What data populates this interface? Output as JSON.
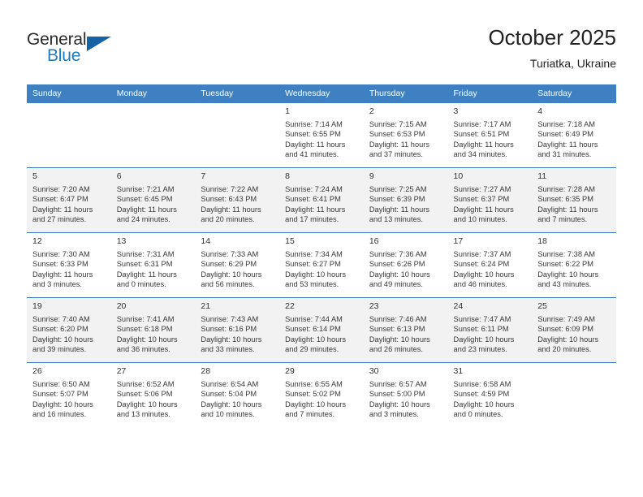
{
  "brand": {
    "name_top": "General",
    "name_bottom": "Blue",
    "accent_color": "#1f7ac4",
    "triangle_color": "#1464a5"
  },
  "header": {
    "title": "October 2025",
    "subtitle": "Turiatka, Ukraine"
  },
  "theme": {
    "header_row_bg": "#3f80c3",
    "header_row_text": "#ffffff",
    "alt_row_bg": "#f2f2f2",
    "row_divider": "#3f80c3"
  },
  "weekday_headers": [
    "Sunday",
    "Monday",
    "Tuesday",
    "Wednesday",
    "Thursday",
    "Friday",
    "Saturday"
  ],
  "weeks": [
    {
      "alt": false,
      "days": [
        {
          "empty": true
        },
        {
          "empty": true
        },
        {
          "empty": true
        },
        {
          "num": "1",
          "sunrise": "Sunrise: 7:14 AM",
          "sunset": "Sunset: 6:55 PM",
          "daylight1": "Daylight: 11 hours",
          "daylight2": "and 41 minutes."
        },
        {
          "num": "2",
          "sunrise": "Sunrise: 7:15 AM",
          "sunset": "Sunset: 6:53 PM",
          "daylight1": "Daylight: 11 hours",
          "daylight2": "and 37 minutes."
        },
        {
          "num": "3",
          "sunrise": "Sunrise: 7:17 AM",
          "sunset": "Sunset: 6:51 PM",
          "daylight1": "Daylight: 11 hours",
          "daylight2": "and 34 minutes."
        },
        {
          "num": "4",
          "sunrise": "Sunrise: 7:18 AM",
          "sunset": "Sunset: 6:49 PM",
          "daylight1": "Daylight: 11 hours",
          "daylight2": "and 31 minutes."
        }
      ]
    },
    {
      "alt": true,
      "days": [
        {
          "num": "5",
          "sunrise": "Sunrise: 7:20 AM",
          "sunset": "Sunset: 6:47 PM",
          "daylight1": "Daylight: 11 hours",
          "daylight2": "and 27 minutes."
        },
        {
          "num": "6",
          "sunrise": "Sunrise: 7:21 AM",
          "sunset": "Sunset: 6:45 PM",
          "daylight1": "Daylight: 11 hours",
          "daylight2": "and 24 minutes."
        },
        {
          "num": "7",
          "sunrise": "Sunrise: 7:22 AM",
          "sunset": "Sunset: 6:43 PM",
          "daylight1": "Daylight: 11 hours",
          "daylight2": "and 20 minutes."
        },
        {
          "num": "8",
          "sunrise": "Sunrise: 7:24 AM",
          "sunset": "Sunset: 6:41 PM",
          "daylight1": "Daylight: 11 hours",
          "daylight2": "and 17 minutes."
        },
        {
          "num": "9",
          "sunrise": "Sunrise: 7:25 AM",
          "sunset": "Sunset: 6:39 PM",
          "daylight1": "Daylight: 11 hours",
          "daylight2": "and 13 minutes."
        },
        {
          "num": "10",
          "sunrise": "Sunrise: 7:27 AM",
          "sunset": "Sunset: 6:37 PM",
          "daylight1": "Daylight: 11 hours",
          "daylight2": "and 10 minutes."
        },
        {
          "num": "11",
          "sunrise": "Sunrise: 7:28 AM",
          "sunset": "Sunset: 6:35 PM",
          "daylight1": "Daylight: 11 hours",
          "daylight2": "and 7 minutes."
        }
      ]
    },
    {
      "alt": false,
      "days": [
        {
          "num": "12",
          "sunrise": "Sunrise: 7:30 AM",
          "sunset": "Sunset: 6:33 PM",
          "daylight1": "Daylight: 11 hours",
          "daylight2": "and 3 minutes."
        },
        {
          "num": "13",
          "sunrise": "Sunrise: 7:31 AM",
          "sunset": "Sunset: 6:31 PM",
          "daylight1": "Daylight: 11 hours",
          "daylight2": "and 0 minutes."
        },
        {
          "num": "14",
          "sunrise": "Sunrise: 7:33 AM",
          "sunset": "Sunset: 6:29 PM",
          "daylight1": "Daylight: 10 hours",
          "daylight2": "and 56 minutes."
        },
        {
          "num": "15",
          "sunrise": "Sunrise: 7:34 AM",
          "sunset": "Sunset: 6:27 PM",
          "daylight1": "Daylight: 10 hours",
          "daylight2": "and 53 minutes."
        },
        {
          "num": "16",
          "sunrise": "Sunrise: 7:36 AM",
          "sunset": "Sunset: 6:26 PM",
          "daylight1": "Daylight: 10 hours",
          "daylight2": "and 49 minutes."
        },
        {
          "num": "17",
          "sunrise": "Sunrise: 7:37 AM",
          "sunset": "Sunset: 6:24 PM",
          "daylight1": "Daylight: 10 hours",
          "daylight2": "and 46 minutes."
        },
        {
          "num": "18",
          "sunrise": "Sunrise: 7:38 AM",
          "sunset": "Sunset: 6:22 PM",
          "daylight1": "Daylight: 10 hours",
          "daylight2": "and 43 minutes."
        }
      ]
    },
    {
      "alt": true,
      "days": [
        {
          "num": "19",
          "sunrise": "Sunrise: 7:40 AM",
          "sunset": "Sunset: 6:20 PM",
          "daylight1": "Daylight: 10 hours",
          "daylight2": "and 39 minutes."
        },
        {
          "num": "20",
          "sunrise": "Sunrise: 7:41 AM",
          "sunset": "Sunset: 6:18 PM",
          "daylight1": "Daylight: 10 hours",
          "daylight2": "and 36 minutes."
        },
        {
          "num": "21",
          "sunrise": "Sunrise: 7:43 AM",
          "sunset": "Sunset: 6:16 PM",
          "daylight1": "Daylight: 10 hours",
          "daylight2": "and 33 minutes."
        },
        {
          "num": "22",
          "sunrise": "Sunrise: 7:44 AM",
          "sunset": "Sunset: 6:14 PM",
          "daylight1": "Daylight: 10 hours",
          "daylight2": "and 29 minutes."
        },
        {
          "num": "23",
          "sunrise": "Sunrise: 7:46 AM",
          "sunset": "Sunset: 6:13 PM",
          "daylight1": "Daylight: 10 hours",
          "daylight2": "and 26 minutes."
        },
        {
          "num": "24",
          "sunrise": "Sunrise: 7:47 AM",
          "sunset": "Sunset: 6:11 PM",
          "daylight1": "Daylight: 10 hours",
          "daylight2": "and 23 minutes."
        },
        {
          "num": "25",
          "sunrise": "Sunrise: 7:49 AM",
          "sunset": "Sunset: 6:09 PM",
          "daylight1": "Daylight: 10 hours",
          "daylight2": "and 20 minutes."
        }
      ]
    },
    {
      "alt": false,
      "days": [
        {
          "num": "26",
          "sunrise": "Sunrise: 6:50 AM",
          "sunset": "Sunset: 5:07 PM",
          "daylight1": "Daylight: 10 hours",
          "daylight2": "and 16 minutes."
        },
        {
          "num": "27",
          "sunrise": "Sunrise: 6:52 AM",
          "sunset": "Sunset: 5:06 PM",
          "daylight1": "Daylight: 10 hours",
          "daylight2": "and 13 minutes."
        },
        {
          "num": "28",
          "sunrise": "Sunrise: 6:54 AM",
          "sunset": "Sunset: 5:04 PM",
          "daylight1": "Daylight: 10 hours",
          "daylight2": "and 10 minutes."
        },
        {
          "num": "29",
          "sunrise": "Sunrise: 6:55 AM",
          "sunset": "Sunset: 5:02 PM",
          "daylight1": "Daylight: 10 hours",
          "daylight2": "and 7 minutes."
        },
        {
          "num": "30",
          "sunrise": "Sunrise: 6:57 AM",
          "sunset": "Sunset: 5:00 PM",
          "daylight1": "Daylight: 10 hours",
          "daylight2": "and 3 minutes."
        },
        {
          "num": "31",
          "sunrise": "Sunrise: 6:58 AM",
          "sunset": "Sunset: 4:59 PM",
          "daylight1": "Daylight: 10 hours",
          "daylight2": "and 0 minutes."
        },
        {
          "empty": true
        }
      ]
    }
  ]
}
